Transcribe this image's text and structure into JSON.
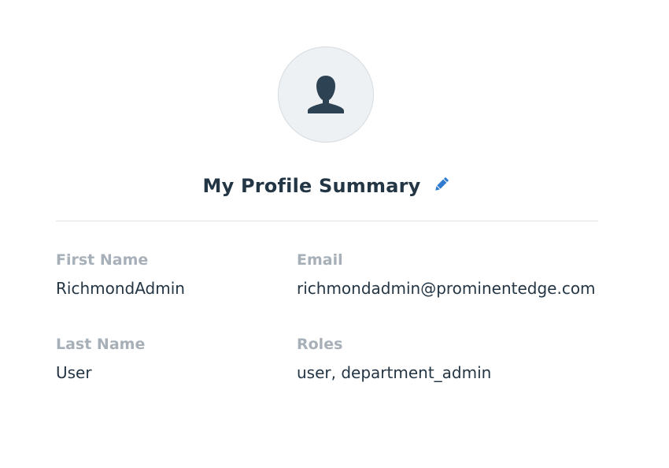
{
  "profile": {
    "avatar_icon": "user-silhouette-icon",
    "title": "My Profile Summary",
    "edit_icon": "pencil-icon",
    "fields": {
      "first_name": {
        "label": "First Name",
        "value": "RichmondAdmin"
      },
      "email": {
        "label": "Email",
        "value": "richmondadmin@prominentedge.com"
      },
      "last_name": {
        "label": "Last Name",
        "value": "User"
      },
      "roles": {
        "label": "Roles",
        "value": "user, department_admin"
      }
    }
  },
  "colors": {
    "heading": "#233645",
    "label": "#a7b0b8",
    "value": "#243544",
    "accent": "#2f7bd0",
    "avatar_bg": "#eef1f4",
    "avatar_icon": "#2d4354"
  }
}
